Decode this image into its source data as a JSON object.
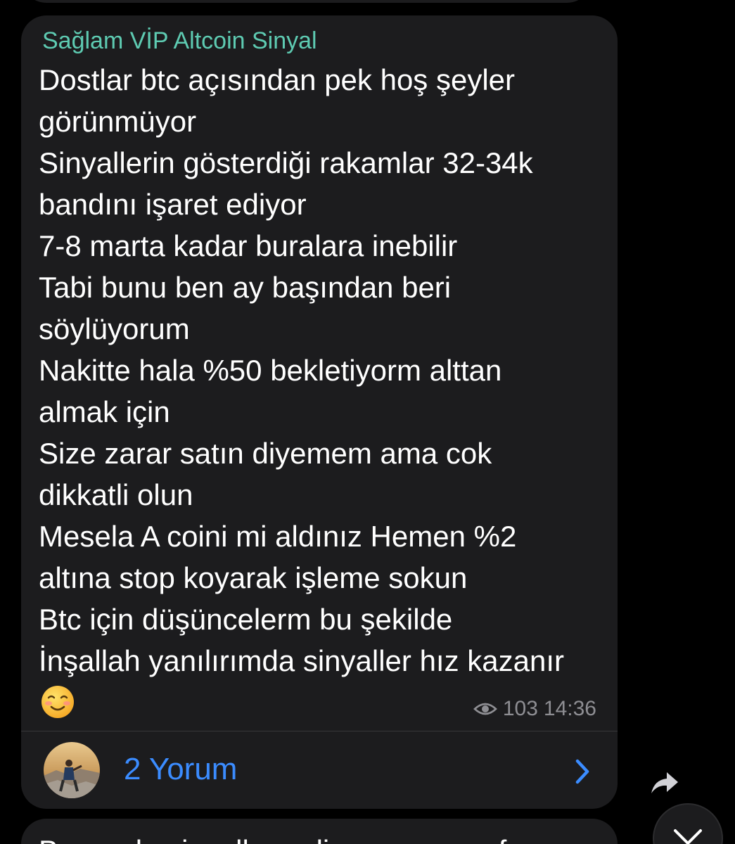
{
  "message": {
    "sender": "Sağlam VİP Altcoin Sinyal",
    "lines": [
      "Dostlar btc açısından pek hoş şeyler",
      "görünmüyor",
      "Sinyallerin gösterdiği rakamlar 32-34k",
      "bandını işaret ediyor",
      "7-8 marta kadar buralara inebilir",
      "Tabi bunu ben ay başından beri",
      "söylüyorum",
      "Nakitte hala %50 bekletiyorm alttan",
      "almak için",
      "Size zarar satın diyemem ama cok",
      "dikkatli olun",
      "Mesela A coini mi aldınız Hemen %2",
      "altına stop koyarak işleme sokun",
      "Btc için düşüncelerm bu şekilde",
      "İnşallah yanılırımda sinyaller hız kazanır"
    ],
    "emoji": "smiling-face-emoji",
    "views": "103",
    "time": "14:36"
  },
  "comments": {
    "label": "2 Yorum",
    "avatar_icon": "user-avatar"
  },
  "next_message": {
    "partial_text": "Bu arada sinyaller geliyor ama zayıf"
  },
  "icons": {
    "eye": "eye-icon",
    "chevron": "chevron-right-icon",
    "share": "share-icon",
    "scroll": "chevron-down-icon"
  },
  "colors": {
    "background": "#000000",
    "bubble": "#1c1c1e",
    "sender_name": "#5ecbb2",
    "link_blue": "#3b8cff",
    "meta_gray": "#8e8e93",
    "text": "#ffffff"
  }
}
